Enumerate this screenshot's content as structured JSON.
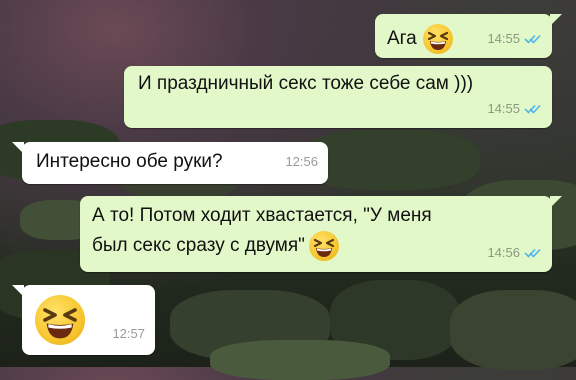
{
  "messages": [
    {
      "text": "Ага",
      "time": "14:55",
      "emoji": "laughing-squint-emoji",
      "status": "read"
    },
    {
      "text": "И праздничный секс тоже себе сам )))",
      "time": "14:55",
      "status": "read"
    },
    {
      "text": "Интересно обе руки?",
      "time": "12:56"
    },
    {
      "line1": "А то! Потом ходит хвастается, \"У меня",
      "line2": "был секс сразу с двумя\"",
      "time": "14:56",
      "emoji": "laughing-squint-emoji",
      "status": "read"
    },
    {
      "text": "",
      "time": "12:57",
      "emoji": "laughing-squint-emoji"
    }
  ],
  "colors": {
    "outgoing_bubble": "#e2f8c9",
    "incoming_bubble": "#ffffff",
    "read_ticks": "#4fb6ec"
  }
}
